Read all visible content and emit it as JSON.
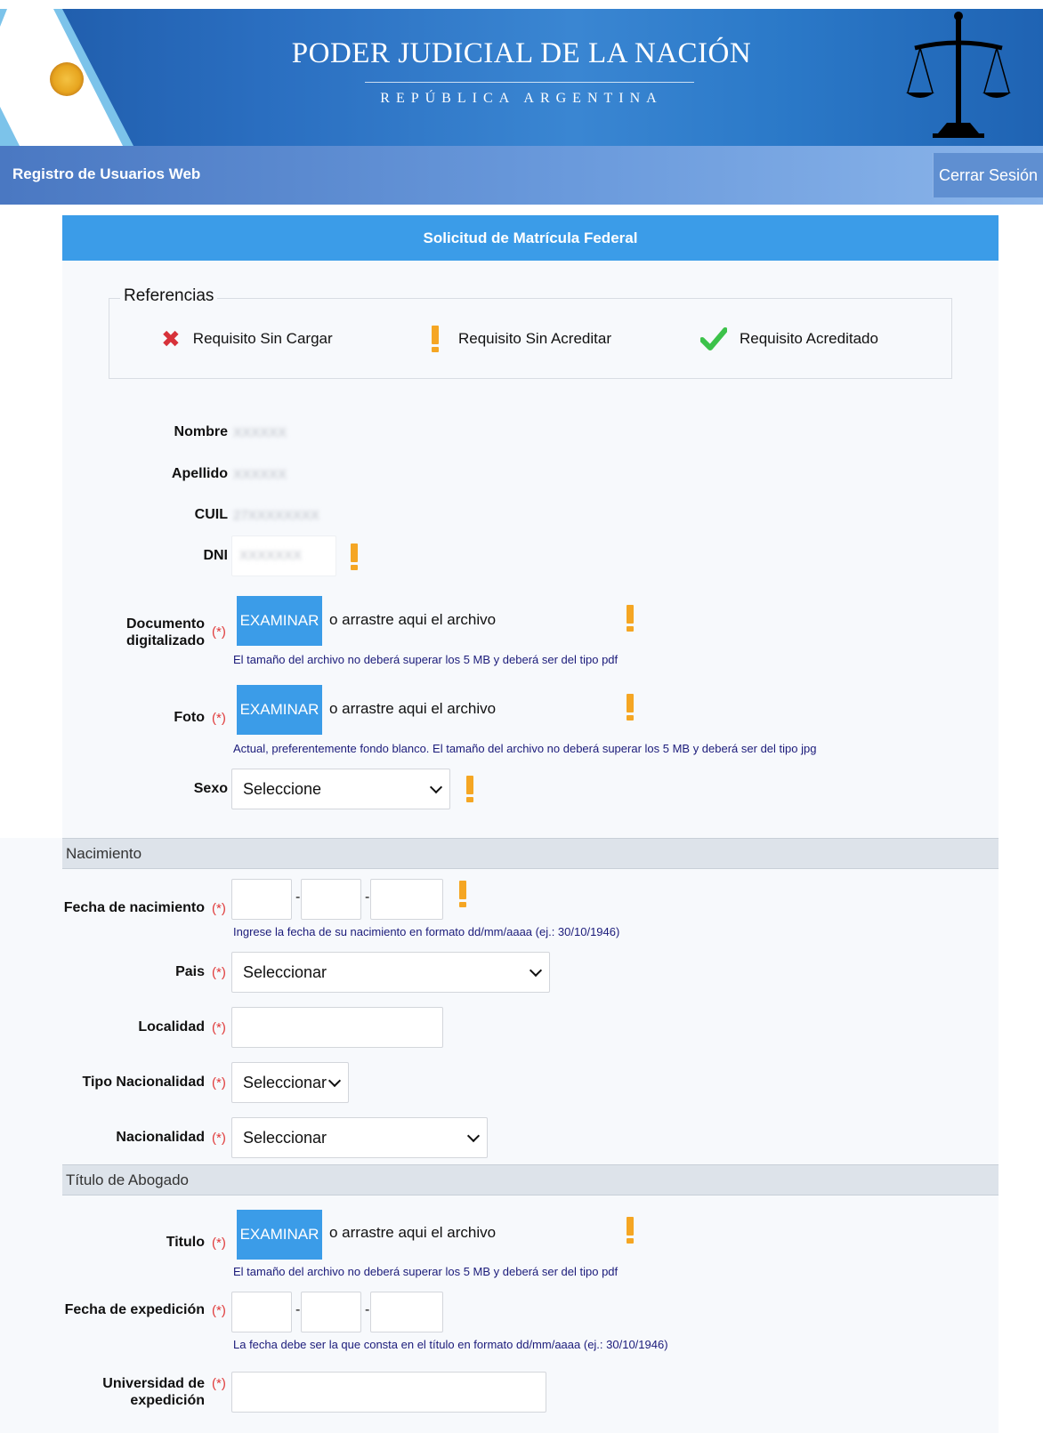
{
  "header": {
    "title": "PODER JUDICIAL DE LA NACIÓN",
    "subtitle": "REPÚBLICA ARGENTINA",
    "logo_icon": "argentine-sun-icon",
    "emblem_icon": "scales-of-justice-icon"
  },
  "navbar": {
    "title": "Registro de Usuarios Web",
    "logout_label": "Cerrar Sesión"
  },
  "form": {
    "title": "Solicitud de Matrícula Federal",
    "references": {
      "legend": "Referencias",
      "items": [
        {
          "icon": "x-icon",
          "label": "Requisito Sin Cargar"
        },
        {
          "icon": "warning-icon",
          "label": "Requisito Sin Acreditar"
        },
        {
          "icon": "check-icon",
          "label": "Requisito Acreditado"
        }
      ]
    },
    "required_mark": "(*)",
    "fields": {
      "nombre": {
        "label": "Nombre",
        "value": "XXXXXX"
      },
      "apellido": {
        "label": "Apellido",
        "value": "XXXXXX"
      },
      "cuil": {
        "label": "CUIL",
        "value": "27XXXXXXXX"
      },
      "dni": {
        "label": "DNI",
        "value": "XXXXXXX"
      },
      "documento": {
        "label_line1": "Documento",
        "label_line2": "digitalizado",
        "button": "EXAMINAR",
        "drop_text": "o arrastre aqui el archivo",
        "hint": "El tamaño del archivo no deberá superar los 5 MB y deberá ser del tipo pdf"
      },
      "foto": {
        "label": "Foto",
        "button": "EXAMINAR",
        "drop_text": "o arrastre aqui el archivo",
        "hint": "Actual, preferentemente fondo blanco. El tamaño del archivo no deberá superar los 5 MB y deberá ser del tipo jpg"
      },
      "sexo": {
        "label": "Sexo",
        "selected": "Seleccione"
      }
    },
    "sections": {
      "nacimiento": {
        "title": "Nacimiento",
        "fecha": {
          "label": "Fecha de nacimiento",
          "sep": "-",
          "hint": "Ingrese la fecha de su nacimiento en formato dd/mm/aaaa (ej.: 30/10/1946)"
        },
        "pais": {
          "label": "Pais",
          "selected": "Seleccionar"
        },
        "localidad": {
          "label": "Localidad",
          "value": ""
        },
        "tipo_nacionalidad": {
          "label": "Tipo Nacionalidad",
          "selected": "Seleccionar"
        },
        "nacionalidad": {
          "label": "Nacionalidad",
          "selected": "Seleccionar"
        }
      },
      "titulo": {
        "title": "Título de Abogado",
        "titulo_file": {
          "label": "Titulo",
          "button": "EXAMINAR",
          "drop_text": "o arrastre aqui el archivo",
          "hint": "El tamaño del archivo no deberá superar los 5 MB y deberá ser del tipo pdf"
        },
        "fecha_expedicion": {
          "label": "Fecha de expedición",
          "sep": "-",
          "hint": "La fecha debe ser la que consta en el título en formato dd/mm/aaaa (ej.: 30/10/1946)"
        },
        "universidad": {
          "label_line1": "Universidad de",
          "label_line2": "expedición",
          "value": ""
        }
      }
    }
  }
}
